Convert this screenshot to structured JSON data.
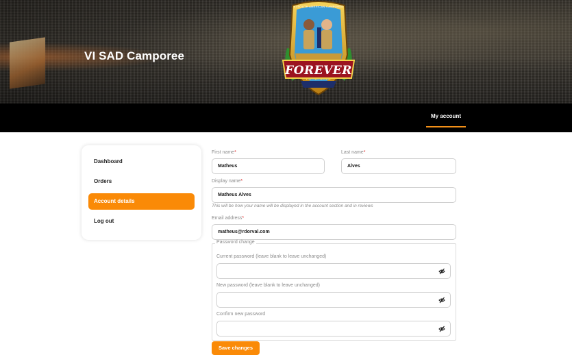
{
  "header": {
    "site_title": "VI SAD Camporee",
    "logo": {
      "arc_text": "VI SOUTH AMERICAN CAMPOREE",
      "main_text": "FOREVER",
      "sub_text": "PATHFINDER"
    }
  },
  "nav": {
    "items": [
      {
        "label": "My account",
        "active": true
      }
    ]
  },
  "sidebar": {
    "items": [
      {
        "label": "Dashboard",
        "active": false
      },
      {
        "label": "Orders",
        "active": false
      },
      {
        "label": "Account details",
        "active": true
      },
      {
        "label": "Log out",
        "active": false
      }
    ]
  },
  "form": {
    "first_name": {
      "label": "First name",
      "required_mark": "*",
      "value": "Matheus"
    },
    "last_name": {
      "label": "Last name",
      "required_mark": "*",
      "value": "Alves"
    },
    "display_name": {
      "label": "Display name",
      "required_mark": "*",
      "value": "Matheus Alves",
      "hint": "This will be how your name will be displayed in the account section and in reviews"
    },
    "email": {
      "label": "Email address",
      "required_mark": "*",
      "value": "matheus@rdorval.com"
    },
    "password_change": {
      "legend": "Password change",
      "current": {
        "label": "Current password (leave blank to leave unchanged)",
        "value": ""
      },
      "new": {
        "label": "New password (leave blank to leave unchanged)",
        "value": ""
      },
      "confirm": {
        "label": "Confirm new password",
        "value": ""
      },
      "toggle_icon": "eye-slash-icon"
    },
    "save_label": "Save changes"
  },
  "colors": {
    "accent": "#fa8a07",
    "nav_background": "#000000",
    "required": "#dd2222"
  }
}
